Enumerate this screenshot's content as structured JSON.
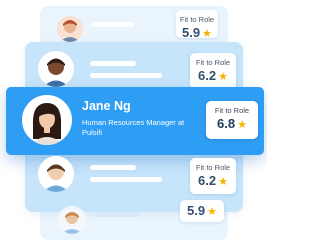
{
  "colors": {
    "accent": "#2e9df4",
    "card_back": "#e9f4fd",
    "card_mid": "#c6e4fa",
    "star": "#f5b400"
  },
  "rows": [
    {
      "score_label": "Fit to Role",
      "score_value": "5.9",
      "star_icon": "star-icon"
    },
    {
      "score_label": "Fit to Role",
      "score_value": "6.2",
      "star_icon": "star-icon"
    },
    {
      "score_label": "Fit to Role",
      "score_value": "6.2",
      "star_icon": "star-icon"
    },
    {
      "score_label": "",
      "score_value": "5.9",
      "star_icon": "star-icon"
    }
  ],
  "highlight": {
    "name": "Jane Ng",
    "title": "Human Resources Manager at Pulsifi",
    "score_label": "Fit to Role",
    "score_value": "6.8",
    "star_icon": "star-icon"
  }
}
